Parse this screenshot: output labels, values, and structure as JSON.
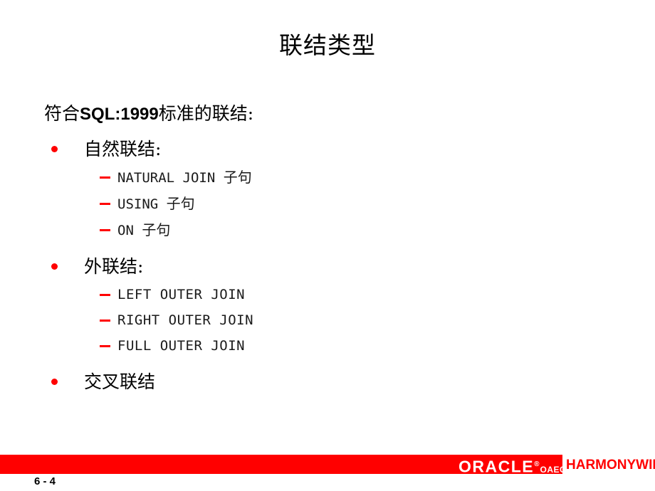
{
  "slide": {
    "title": "联结类型",
    "lead_line_prefix": "符合",
    "lead_line_ascii": "SQL:1999",
    "lead_line_suffix": "标准的联结:",
    "bullets": [
      {
        "label": "自然联结:",
        "subitems": [
          {
            "code": "NATURAL JOIN ",
            "cjk": "子句"
          },
          {
            "code": "USING ",
            "cjk": "子句"
          },
          {
            "code": "ON ",
            "cjk": "子句"
          }
        ]
      },
      {
        "label": "外联结:",
        "subitems": [
          {
            "code": "LEFT OUTER JOIN",
            "cjk": ""
          },
          {
            "code": "RIGHT OUTER JOIN",
            "cjk": ""
          },
          {
            "code": "FULL OUTER JOIN",
            "cjk": ""
          }
        ]
      },
      {
        "label": "交叉联结",
        "subitems": []
      }
    ]
  },
  "footer": {
    "oracle_wordmark": "ORACLE",
    "oracle_registered": "®",
    "oracle_suffix": "OAEC",
    "partner_wordmark": "HARMONYWIN",
    "page_number": "6 - 4"
  },
  "colors": {
    "accent_red": "#ff0000",
    "text_black": "#000000",
    "background": "#ffffff"
  }
}
